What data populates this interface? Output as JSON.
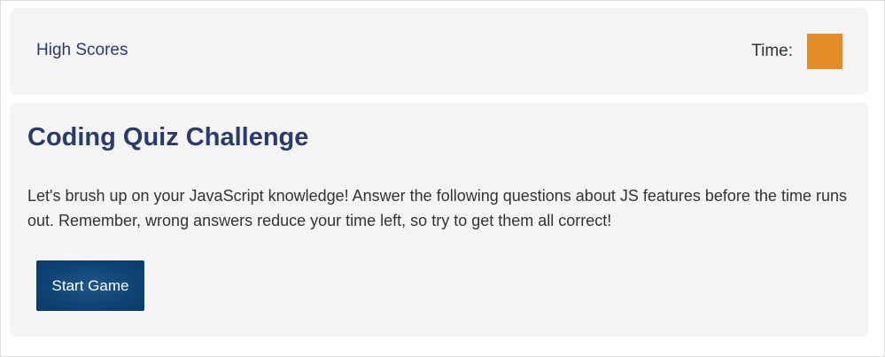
{
  "header": {
    "high_scores_label": "High Scores",
    "timer_label": "Time:",
    "timer_value": "",
    "timer_color": "#e38c26"
  },
  "quiz": {
    "title": "Coding Quiz Challenge",
    "description": "Let's brush up on your JavaScript knowledge! Answer the following questions about JS features before the time runs out. Remember, wrong answers reduce your time left, so try to get them all correct!",
    "start_button_label": "Start Game",
    "button_color": "#0f4376",
    "title_color": "#293b6b"
  }
}
